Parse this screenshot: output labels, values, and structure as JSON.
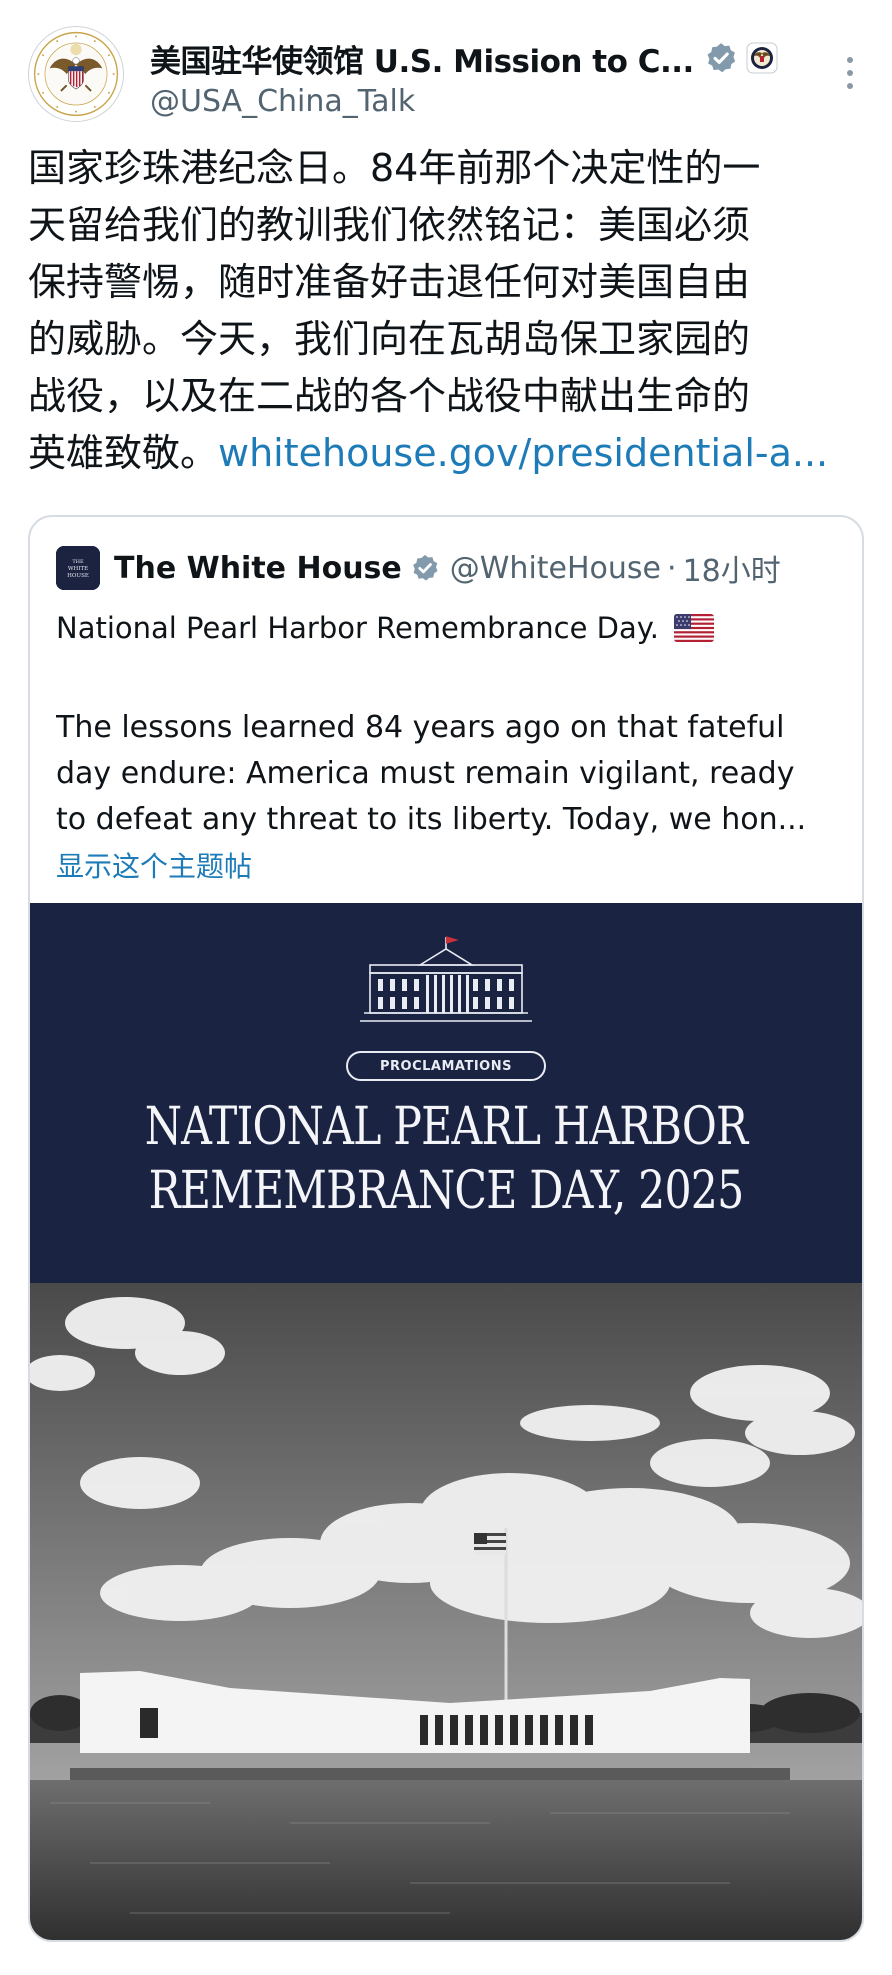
{
  "author": {
    "display_name": "美国驻华使领馆 U.S. Mission to C...",
    "handle": "@USA_China_Talk",
    "verified_icon": "verified-check-icon",
    "affiliation_icon": "state-department-seal-icon"
  },
  "tweet": {
    "lines": [
      "国家珍珠港纪念日。84年前那个决定性的一",
      "天留给我们的教训我们依然铭记：美国必须",
      "保持警惕，随时准备好击退任何对美国自由",
      "的威胁。今天，我们向在瓦胡岛保卫家园的",
      "战役，以及在二战的各个战役中献出生命的"
    ],
    "last_line_text": "英雄致敬。",
    "link": "whitehouse.gov/presidential-a..."
  },
  "quote": {
    "author_name": "The White House",
    "author_handle": "@WhiteHouse",
    "separator": "·",
    "time": "18小时",
    "title": "National Pearl Harbor Remembrance Day.",
    "body_lines": [
      "The lessons learned 84 years ago on that fateful",
      "day endure: America must remain vigilant, ready",
      "to defeat any threat to its liberty. Today, we hon..."
    ],
    "show_thread": "显示这个主题帖",
    "avatar_text": "THE WHITE HOUSE"
  },
  "media": {
    "pill": "PROCLAMATIONS",
    "headline_lines": [
      "NATIONAL PEARL HARBOR",
      "REMEMBRANCE DAY, 2025"
    ],
    "banner_color": "#1b2342",
    "photo_description_icon": "uss-arizona-memorial-photo"
  },
  "colors": {
    "link": "#1d7bb8",
    "verified": "#829aab",
    "secondary_text": "#536471"
  }
}
